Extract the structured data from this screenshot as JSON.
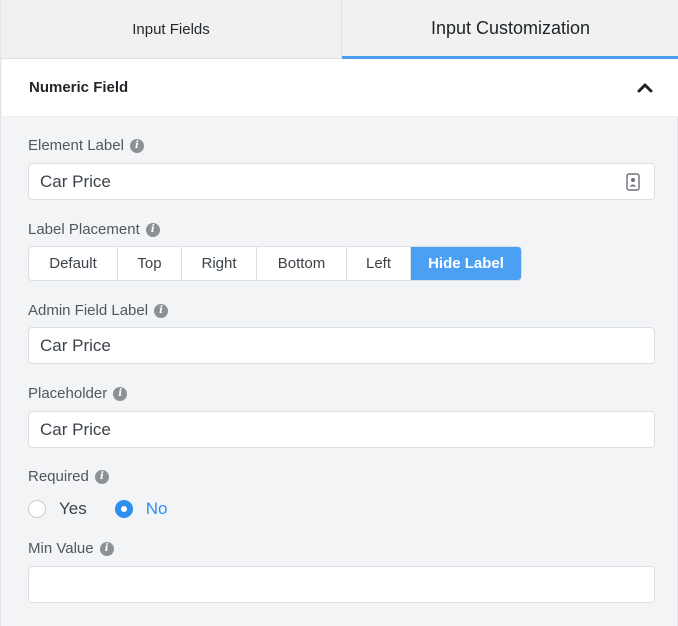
{
  "tabs": [
    {
      "label": "Input Fields"
    },
    {
      "label": "Input Customization"
    }
  ],
  "section": {
    "title": "Numeric Field"
  },
  "fields": {
    "element_label": {
      "label": "Element Label",
      "value": "Car Price"
    },
    "label_placement": {
      "label": "Label Placement",
      "options": [
        "Default",
        "Top",
        "Right",
        "Bottom",
        "Left",
        "Hide Label"
      ],
      "selected": "Hide Label"
    },
    "admin_field_label": {
      "label": "Admin Field Label",
      "value": "Car Price"
    },
    "placeholder": {
      "label": "Placeholder",
      "value": "Car Price"
    },
    "required": {
      "label": "Required",
      "options": [
        "Yes",
        "No"
      ],
      "selected": "No"
    },
    "min_value": {
      "label": "Min Value",
      "value": ""
    }
  },
  "colors": {
    "accent": "#4ba0f3",
    "radio_checked": "#2f8fee"
  },
  "icons": {
    "info": "info-icon",
    "collapse": "chevron-up-icon",
    "contact": "contact-card-icon"
  }
}
